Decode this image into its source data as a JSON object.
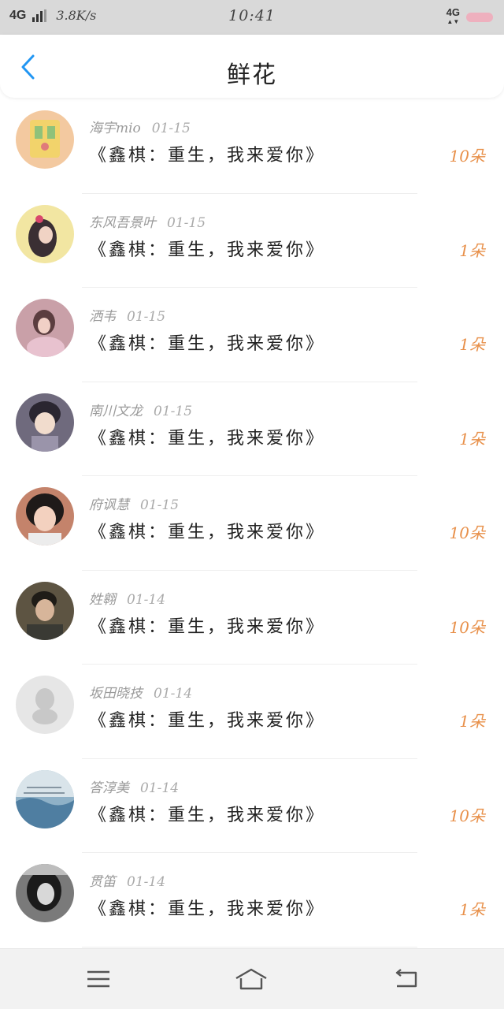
{
  "status_bar": {
    "network": "4G",
    "speed": "3.8K/s",
    "time": "10:41",
    "right_network": "4G"
  },
  "header": {
    "title": "鲜花",
    "back_icon": "chevron-left-icon"
  },
  "list": [
    {
      "user": "海宇mio",
      "date": "01-15",
      "book": "《鑫棋：重生，我来爱你》",
      "flowers": "10朵",
      "avatar_color": "#f3c9a0"
    },
    {
      "user": "东风吾景叶",
      "date": "01-15",
      "book": "《鑫棋：重生，我来爱你》",
      "flowers": "1朵",
      "avatar_color": "#f2e6a2"
    },
    {
      "user": "洒韦",
      "date": "01-15",
      "book": "《鑫棋：重生，我来爱你》",
      "flowers": "1朵",
      "avatar_color": "#c9a0a8"
    },
    {
      "user": "南川文龙",
      "date": "01-15",
      "book": "《鑫棋：重生，我来爱你》",
      "flowers": "1朵",
      "avatar_color": "#6f6a7d"
    },
    {
      "user": "府讽慧",
      "date": "01-15",
      "book": "《鑫棋：重生，我来爱你》",
      "flowers": "10朵",
      "avatar_color": "#c4836b"
    },
    {
      "user": "姓翱",
      "date": "01-14",
      "book": "《鑫棋：重生，我来爱你》",
      "flowers": "10朵",
      "avatar_color": "#5d5442"
    },
    {
      "user": "坂田晓技",
      "date": "01-14",
      "book": "《鑫棋：重生，我来爱你》",
      "flowers": "1朵",
      "avatar_color": "#e6e6e6"
    },
    {
      "user": "答淳美",
      "date": "01-14",
      "book": "《鑫棋：重生，我来爱你》",
      "flowers": "10朵",
      "avatar_color": "#8fb1c7"
    },
    {
      "user": "贯笛",
      "date": "01-14",
      "book": "《鑫棋：重生，我来爱你》",
      "flowers": "1朵",
      "avatar_color": "#7a7a7a"
    }
  ],
  "bottom_nav": {
    "menu_icon": "menu-icon",
    "home_icon": "home-icon",
    "back_icon": "back-arrow-icon"
  },
  "colors": {
    "accent": "#2196f3",
    "flowers": "#e8904a",
    "status_bar_bg": "#d9d9d9"
  }
}
